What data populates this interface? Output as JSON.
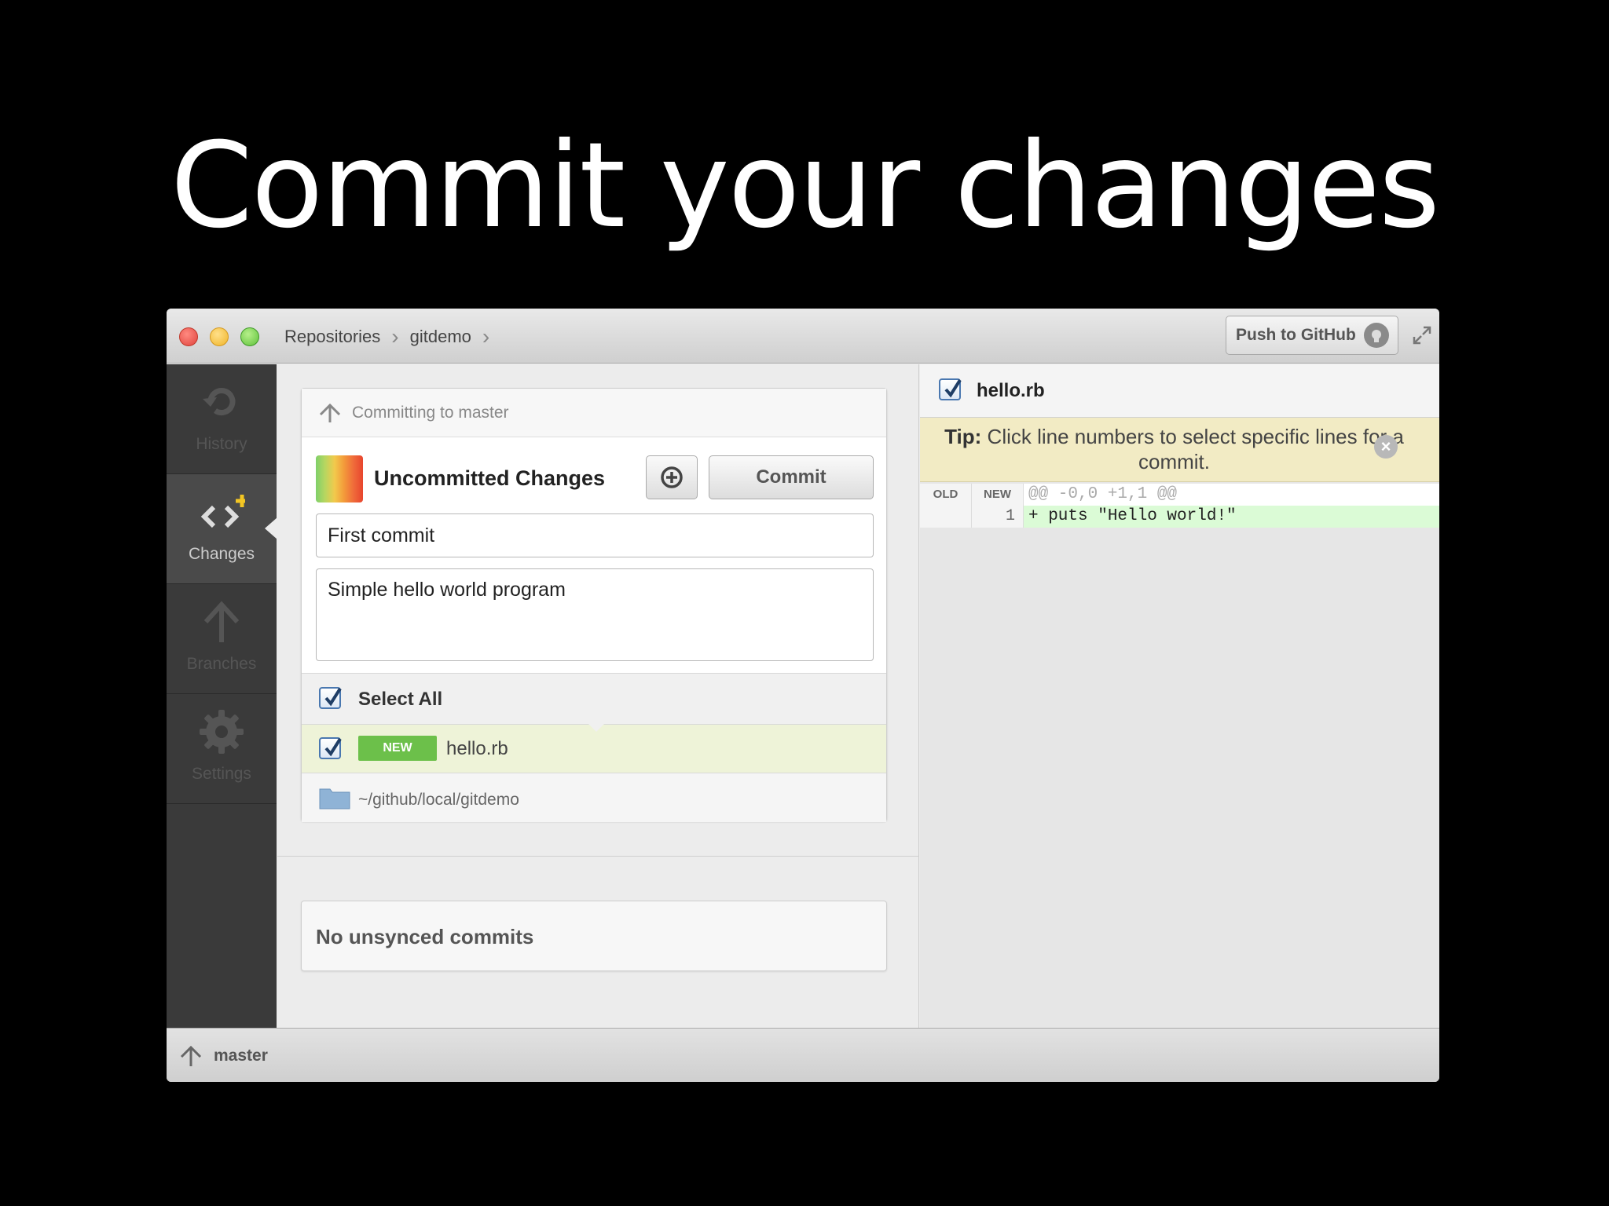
{
  "slide": {
    "title": "Commit your changes"
  },
  "titlebar": {
    "breadcrumbs": [
      "Repositories",
      "gitdemo"
    ],
    "push_label": "Push to GitHub"
  },
  "sidebar": {
    "items": [
      {
        "label": "History",
        "icon": "history-icon"
      },
      {
        "label": "Changes",
        "icon": "changes-icon"
      },
      {
        "label": "Branches",
        "icon": "branches-icon"
      },
      {
        "label": "Settings",
        "icon": "gear-icon"
      }
    ],
    "active": "Changes"
  },
  "commit_panel": {
    "header": "Committing to master",
    "title": "Uncommitted Changes",
    "commit_button": "Commit",
    "summary_value": "First commit",
    "description_value": "Simple hello world program",
    "select_all_label": "Select All",
    "files": [
      {
        "status": "NEW",
        "name": "hello.rb",
        "checked": true
      }
    ],
    "repo_path": "~/github/local/gitdemo"
  },
  "unsynced": {
    "label": "No unsynced commits"
  },
  "diff": {
    "file": "hello.rb",
    "tip_bold": "Tip:",
    "tip_text": "Click line numbers to select specific lines for a commit.",
    "col_old": "OLD",
    "col_new": "NEW",
    "hunk": "@@ -0,0 +1,1 @@",
    "lines": [
      {
        "old": "",
        "new": "1",
        "code": "+ puts \"Hello world!\""
      }
    ]
  },
  "statusbar": {
    "branch": "master"
  },
  "colors": {
    "added_bg": "#dbfbd6",
    "new_badge": "#6cc04a",
    "tip_bg": "#f2ebc4"
  }
}
